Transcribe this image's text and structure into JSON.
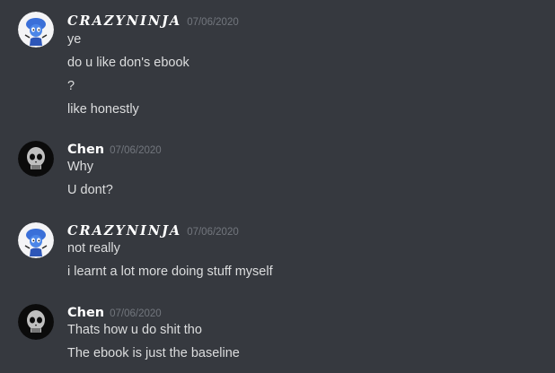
{
  "messages": [
    {
      "author": "CRAZYNINJA",
      "timestamp": "07/06/2020",
      "avatar_icon": "smurf-avatar-icon",
      "lines": [
        "ye",
        "do u like don's ebook",
        "?",
        "like honestly"
      ]
    },
    {
      "author": "Chen",
      "timestamp": "07/06/2020",
      "avatar_icon": "skull-avatar-icon",
      "lines": [
        "Why",
        "U dont?"
      ]
    },
    {
      "author": "CRAZYNINJA",
      "timestamp": "07/06/2020",
      "avatar_icon": "smurf-avatar-icon",
      "lines": [
        "not really",
        "i learnt a lot more doing stuff myself"
      ]
    },
    {
      "author": "Chen",
      "timestamp": "07/06/2020",
      "avatar_icon": "skull-avatar-icon",
      "lines": [
        "Thats how u do shit tho",
        "The ebook is just the baseline"
      ]
    }
  ],
  "colors": {
    "background": "#36393f",
    "username": "#ffffff",
    "timestamp": "#72767d",
    "text": "#dcddde"
  }
}
